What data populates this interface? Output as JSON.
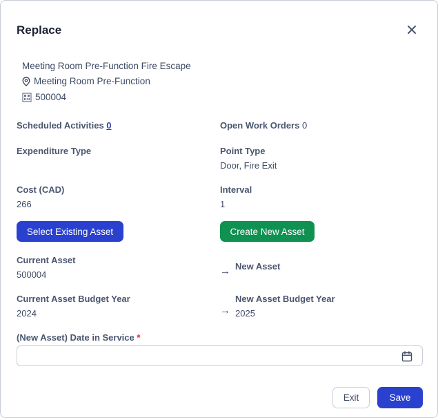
{
  "dialog": {
    "title": "Replace",
    "close_icon": "close-icon"
  },
  "asset": {
    "name": "Meeting Room Pre-Function Fire Escape",
    "location": "Meeting Room Pre-Function",
    "location_icon": "map-pin-icon",
    "code": "500004",
    "code_icon": "barcode-icon"
  },
  "fields": {
    "scheduled_activities_label": "Scheduled Activities",
    "scheduled_activities_value": "0",
    "open_work_orders_label": "Open Work Orders",
    "open_work_orders_value": "0",
    "expenditure_type_label": "Expenditure Type",
    "expenditure_type_value": "",
    "point_type_label": "Point Type",
    "point_type_value": "Door, Fire Exit",
    "cost_label": "Cost (CAD)",
    "cost_value": "266",
    "interval_label": "Interval",
    "interval_value": "1"
  },
  "actions": {
    "select_existing_label": "Select Existing Asset",
    "create_new_label": "Create New Asset"
  },
  "comparison": {
    "current_asset_label": "Current Asset",
    "current_asset_value": "500004",
    "new_asset_label": "New Asset",
    "new_asset_value": "",
    "current_budget_year_label": "Current Asset Budget Year",
    "current_budget_year_value": "2024",
    "new_budget_year_label": "New Asset Budget Year",
    "new_budget_year_value": "2025",
    "arrow_glyph": "→"
  },
  "date_in_service": {
    "label": "(New Asset) Date in Service",
    "required_mark": "*",
    "value": "",
    "calendar_icon": "calendar-icon"
  },
  "footer": {
    "exit_label": "Exit",
    "save_label": "Save"
  },
  "colors": {
    "primary": "#2a41d0",
    "success": "#0f9152",
    "required": "#d9263a",
    "border": "#c7ccd6"
  }
}
